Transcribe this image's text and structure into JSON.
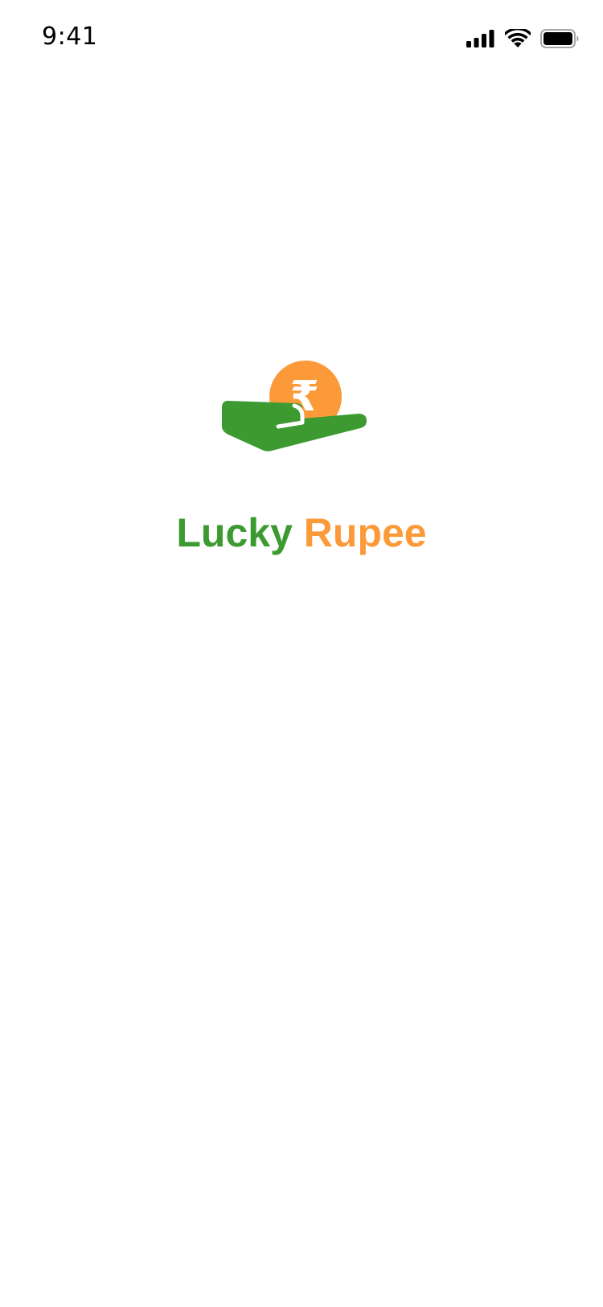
{
  "status_bar": {
    "time": "9:41",
    "icons": [
      "signal-icon",
      "wifi-icon",
      "battery-icon"
    ]
  },
  "splash": {
    "logo_icon": "hand-holding-rupee-coin-icon",
    "logo_symbol": "₹",
    "brand_word_1": "Lucky",
    "brand_word_2": "Rupee"
  },
  "colors": {
    "brand_green": "#3c9a31",
    "brand_orange": "#fc9a3a",
    "background": "#ffffff"
  }
}
